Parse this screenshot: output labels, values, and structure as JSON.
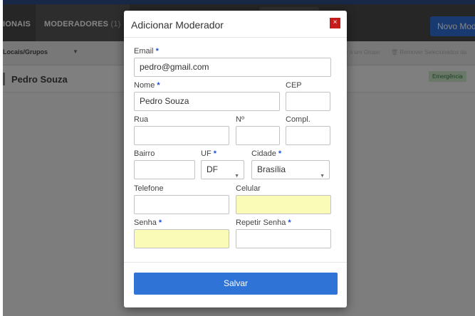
{
  "nav": {
    "tab_partial": "IONAIS",
    "tab_moderadores": "MODERADORES",
    "tab_moderadores_count": "(1)",
    "novo_button": "Novo Mod"
  },
  "toolbar": {
    "filter_label": "Locais/Grupos",
    "action_add_group": "r a um Grupo",
    "action_remove": "Remover Selecionados da"
  },
  "list": {
    "user_name": "Pedro Souza",
    "badge": "Emergência"
  },
  "modal": {
    "title": "Adicionar Moderador",
    "close_glyph": "×",
    "required_mark": "*",
    "fields": {
      "email": {
        "label": "Email",
        "value": "pedro@gmail.com"
      },
      "nome": {
        "label": "Nome",
        "value": "Pedro Souza"
      },
      "cep": {
        "label": "CEP",
        "value": ""
      },
      "rua": {
        "label": "Rua",
        "value": ""
      },
      "numero": {
        "label": "Nº",
        "value": ""
      },
      "compl": {
        "label": "Compl.",
        "value": ""
      },
      "bairro": {
        "label": "Bairro",
        "value": ""
      },
      "uf": {
        "label": "UF",
        "value": "DF"
      },
      "cidade": {
        "label": "Cidade",
        "value": "Brasília"
      },
      "telefone": {
        "label": "Telefone",
        "value": ""
      },
      "celular": {
        "label": "Celular",
        "value": ""
      },
      "senha": {
        "label": "Senha",
        "value": ""
      },
      "repetir_senha": {
        "label": "Repetir Senha",
        "value": ""
      }
    },
    "save_button": "Salvar"
  },
  "colors": {
    "nav_bg": "#4a4a4a",
    "accent_blue": "#2f73d7",
    "close_red": "#c71c1c",
    "required_blue": "#1d4fd4",
    "autofill_yellow": "#fbfbb8",
    "badge_green_bg": "#c9e6c9"
  },
  "icons": {
    "close": "close-icon",
    "select_caret": "chevron-down-icon",
    "trash": "trash-icon"
  }
}
